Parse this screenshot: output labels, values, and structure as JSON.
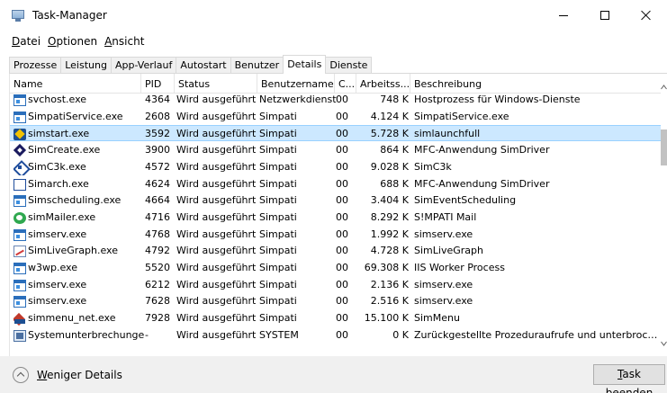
{
  "window": {
    "title": "Task-Manager",
    "icon": "task-manager-icon",
    "controls": [
      "minimize-icon",
      "maximize-icon",
      "close-icon"
    ]
  },
  "menu": [
    {
      "accel": "D",
      "rest": "atei"
    },
    {
      "accel": "O",
      "rest": "ptionen"
    },
    {
      "accel": "A",
      "rest": "nsicht"
    }
  ],
  "tabs": [
    {
      "label": "Prozesse",
      "active": false
    },
    {
      "label": "Leistung",
      "active": false
    },
    {
      "label": "App-Verlauf",
      "active": false
    },
    {
      "label": "Autostart",
      "active": false
    },
    {
      "label": "Benutzer",
      "active": false
    },
    {
      "label": "Details",
      "active": true
    },
    {
      "label": "Dienste",
      "active": false
    }
  ],
  "table": {
    "columns": {
      "name": "Name",
      "pid": "PID",
      "status": "Status",
      "user": "Benutzername",
      "c": "C...",
      "mem": "Arbeitss...",
      "desc": "Beschreibung"
    },
    "sort_column": "user",
    "selected_row": 2,
    "rows": [
      {
        "icon": "window-icon",
        "name": "svchost.exe",
        "pid": "4364",
        "status": "Wird ausgeführt",
        "user": "Netzwerkdienst",
        "c": "00",
        "mem": "748 K",
        "desc": "Hostprozess für Windows-Dienste"
      },
      {
        "icon": "window-icon",
        "name": "SimpatiService.exe",
        "pid": "2608",
        "status": "Wird ausgeführt",
        "user": "Simpati",
        "c": "00",
        "mem": "4.124 K",
        "desc": "SimpatiService.exe"
      },
      {
        "icon": "simstart-icon",
        "name": "simstart.exe",
        "pid": "3592",
        "status": "Wird ausgeführt",
        "user": "Simpati",
        "c": "00",
        "mem": "5.728 K",
        "desc": "simlaunchfull"
      },
      {
        "icon": "simcreate-icon",
        "name": "SimCreate.exe",
        "pid": "3900",
        "status": "Wird ausgeführt",
        "user": "Simpati",
        "c": "00",
        "mem": "864 K",
        "desc": "MFC-Anwendung SimDriver"
      },
      {
        "icon": "simc3k-icon",
        "name": "SimC3k.exe",
        "pid": "4572",
        "status": "Wird ausgeführt",
        "user": "Simpati",
        "c": "00",
        "mem": "9.028 K",
        "desc": "SimC3k"
      },
      {
        "icon": "simarch-icon",
        "name": "Simarch.exe",
        "pid": "4624",
        "status": "Wird ausgeführt",
        "user": "Simpati",
        "c": "00",
        "mem": "688 K",
        "desc": "MFC-Anwendung SimDriver"
      },
      {
        "icon": "window-icon",
        "name": "Simscheduling.exe",
        "pid": "4664",
        "status": "Wird ausgeführt",
        "user": "Simpati",
        "c": "00",
        "mem": "3.404 K",
        "desc": "SimEventScheduling"
      },
      {
        "icon": "simmailer-icon",
        "name": "simMailer.exe",
        "pid": "4716",
        "status": "Wird ausgeführt",
        "user": "Simpati",
        "c": "00",
        "mem": "8.292 K",
        "desc": "S!MPATI Mail"
      },
      {
        "icon": "window-icon",
        "name": "simserv.exe",
        "pid": "4768",
        "status": "Wird ausgeführt",
        "user": "Simpati",
        "c": "00",
        "mem": "1.992 K",
        "desc": "simserv.exe"
      },
      {
        "icon": "simlivegraph-icon",
        "name": "SimLiveGraph.exe",
        "pid": "4792",
        "status": "Wird ausgeführt",
        "user": "Simpati",
        "c": "00",
        "mem": "4.728 K",
        "desc": "SimLiveGraph"
      },
      {
        "icon": "window-icon",
        "name": "w3wp.exe",
        "pid": "5520",
        "status": "Wird ausgeführt",
        "user": "Simpati",
        "c": "00",
        "mem": "69.308 K",
        "desc": "IIS Worker Process"
      },
      {
        "icon": "window-icon",
        "name": "simserv.exe",
        "pid": "6212",
        "status": "Wird ausgeführt",
        "user": "Simpati",
        "c": "00",
        "mem": "2.136 K",
        "desc": "simserv.exe"
      },
      {
        "icon": "window-icon",
        "name": "simserv.exe",
        "pid": "7628",
        "status": "Wird ausgeführt",
        "user": "Simpati",
        "c": "00",
        "mem": "2.516 K",
        "desc": "simserv.exe"
      },
      {
        "icon": "simmenu-icon",
        "name": "simmenu_net.exe",
        "pid": "7928",
        "status": "Wird ausgeführt",
        "user": "Simpati",
        "c": "00",
        "mem": "15.100 K",
        "desc": "SimMenu"
      },
      {
        "icon": "system-interrupts-icon",
        "name": "Systemunterbrechungen",
        "pid": "-",
        "status": "Wird ausgeführt",
        "user": "SYSTEM",
        "c": "00",
        "mem": "0 K",
        "desc": "Zurückgestellte Prozeduraufrufe und unterbrochene..."
      }
    ]
  },
  "footer": {
    "fewer_details": {
      "accel": "W",
      "rest": "eniger Details"
    },
    "end_task": {
      "accel": "T",
      "rest": "ask beenden"
    }
  }
}
